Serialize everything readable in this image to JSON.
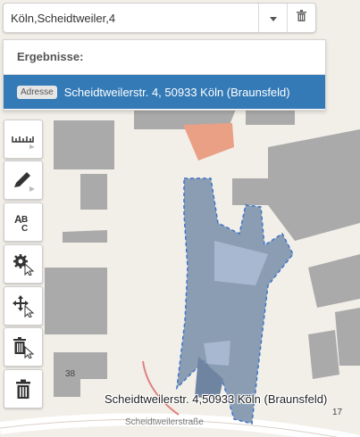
{
  "search": {
    "value": "Köln,Scheidtweiler,4"
  },
  "results": {
    "header": "Ergebnisse:",
    "items": [
      {
        "badge": "Adresse",
        "text": "Scheidtweilerstr. 4, 50933 Köln (Braunsfeld)"
      }
    ]
  },
  "map": {
    "label": "Scheidtweilerstr. 4,50933 Köln (Braunsfeld)",
    "street_label": "Scheidtweilerstraße",
    "house_numbers": [
      "38",
      "17"
    ],
    "colors": {
      "background": "#f2efe9",
      "building": "#a9a9a9",
      "highlight_building": "#e9a084",
      "polygon_fill": "#7f93ad",
      "polygon_stroke": "#3d74c7",
      "selection_blue": "#337ab7"
    }
  },
  "toolbar": {
    "tools": [
      {
        "icon": "ruler-icon",
        "name": "measure"
      },
      {
        "icon": "pencil-icon",
        "name": "draw"
      },
      {
        "icon": "text-abc-icon",
        "name": "text"
      },
      {
        "icon": "gear-cursor-icon",
        "name": "edit-settings"
      },
      {
        "icon": "move-cursor-icon",
        "name": "move"
      },
      {
        "icon": "trash-cursor-icon",
        "name": "delete-feature"
      },
      {
        "icon": "trash-icon",
        "name": "delete-all"
      }
    ]
  }
}
